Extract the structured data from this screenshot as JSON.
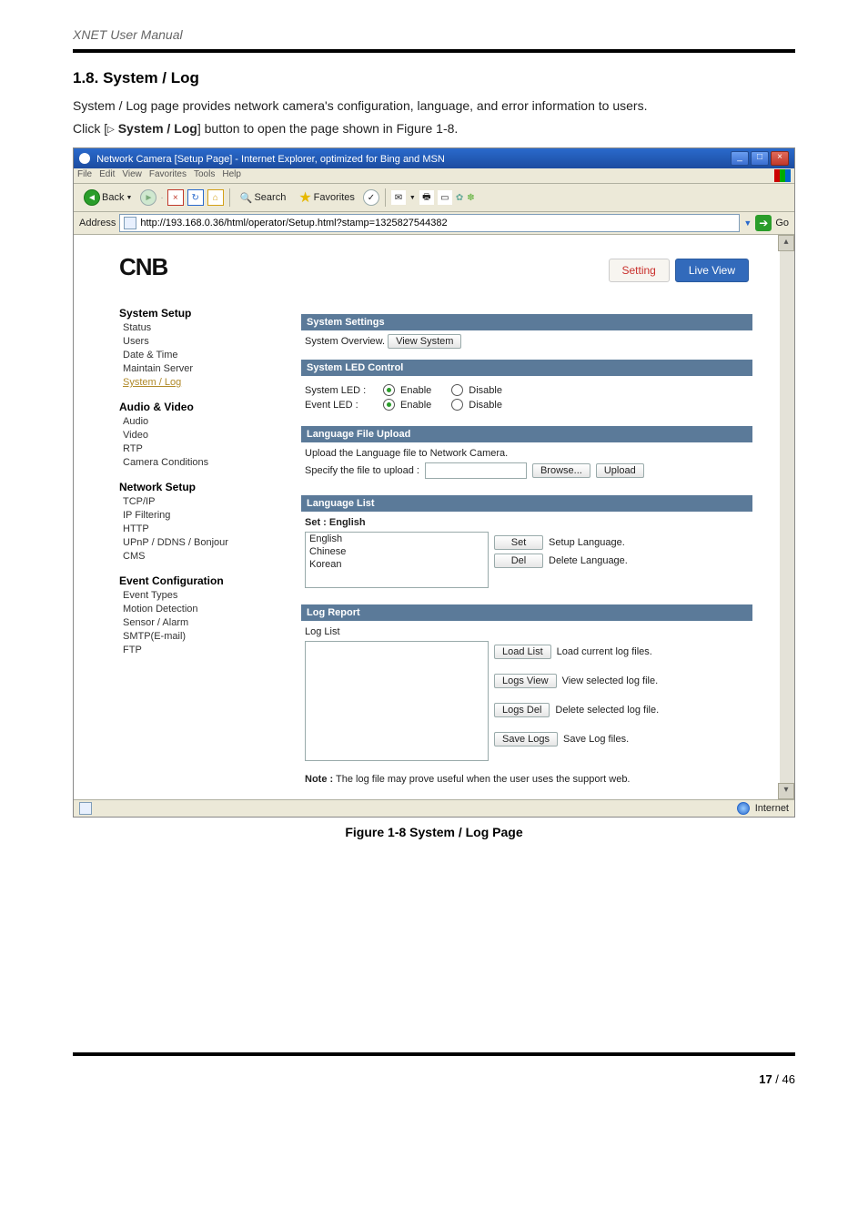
{
  "doc": {
    "header_title": "XNET User Manual",
    "section_number": "1.8. System / Log",
    "intro": "System / Log page provides network camera's configuration, language, and error information to users.",
    "click_pre": "Click [",
    "click_label": "System / Log",
    "click_post": "] button to open the page shown in Figure 1-8.",
    "figure_caption": "Figure 1-8 System / Log Page",
    "page_current": "17",
    "page_sep": " / ",
    "page_total": "46"
  },
  "ie": {
    "title": "Network Camera [Setup Page] - Internet Explorer, optimized for Bing and MSN",
    "menus": [
      "File",
      "Edit",
      "View",
      "Favorites",
      "Tools",
      "Help"
    ],
    "back": "Back",
    "search": "Search",
    "favorites": "Favorites",
    "address_label": "Address",
    "url": "http://193.168.0.36/html/operator/Setup.html?stamp=1325827544382",
    "go": "Go",
    "status_zone": "Internet"
  },
  "setup": {
    "logo": "CNB",
    "tabs": {
      "setting": "Setting",
      "live": "Live View"
    },
    "sidebar": {
      "g1": {
        "title": "System Setup",
        "items": [
          "Status",
          "Users",
          "Date & Time",
          "Maintain Server",
          "System / Log"
        ],
        "active": 4
      },
      "g2": {
        "title": "Audio & Video",
        "items": [
          "Audio",
          "Video",
          "RTP",
          "Camera Conditions"
        ]
      },
      "g3": {
        "title": "Network Setup",
        "items": [
          "TCP/IP",
          "IP Filtering",
          "HTTP",
          "UPnP / DDNS / Bonjour",
          "CMS"
        ]
      },
      "g4": {
        "title": "Event Configuration",
        "items": [
          "Event Types",
          "Motion Detection",
          "Sensor / Alarm",
          "SMTP(E-mail)",
          "FTP"
        ]
      }
    },
    "system_settings": {
      "header": "System Settings",
      "overview_label": "System Overview.",
      "view_btn": "View System"
    },
    "led": {
      "header": "System LED Control",
      "system_label": "System LED :",
      "event_label": "Event LED :",
      "enable": "Enable",
      "disable": "Disable"
    },
    "lang_upload": {
      "header": "Language File Upload",
      "desc": "Upload the Language file to Network Camera.",
      "spec": "Specify the file to upload :",
      "browse": "Browse...",
      "upload": "Upload"
    },
    "lang_list": {
      "header": "Language List",
      "set_label": "Set : English",
      "options": [
        "English",
        "Chinese",
        "Korean"
      ],
      "set_btn": "Set",
      "set_desc": "Setup Language.",
      "del_btn": "Del",
      "del_desc": "Delete Language."
    },
    "log": {
      "header": "Log Report",
      "list_label": "Log List",
      "load_btn": "Load List",
      "load_desc": "Load current log files.",
      "view_btn": "Logs View",
      "view_desc": "View selected log file.",
      "del_btn": "Logs Del",
      "del_desc": "Delete selected log file.",
      "save_btn": "Save Logs",
      "save_desc": "Save Log files.",
      "note_label": "Note :",
      "note_text": " The log file may prove useful when the user uses the support web."
    }
  }
}
